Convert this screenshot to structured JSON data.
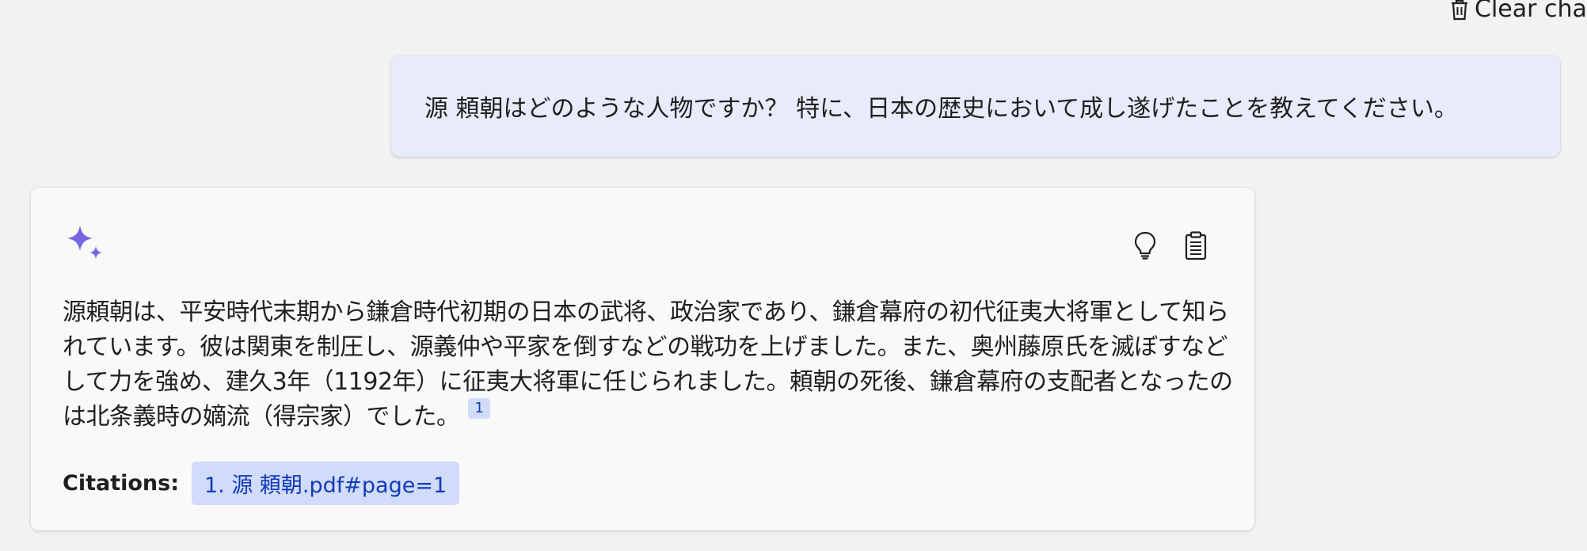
{
  "header": {
    "clear_chat_label": "Clear chat",
    "clear_chat_icon": "trash-icon"
  },
  "user_message": {
    "text": "源 頼朝はどのような人物ですか？ 特に、日本の歴史において成し遂げたことを教えてください。"
  },
  "answer": {
    "avatar_icon": "sparkle-icon",
    "actions": [
      {
        "icon": "lightbulb-icon"
      },
      {
        "icon": "clipboard-icon"
      }
    ],
    "text": "源頼朝は、平安時代末期から鎌倉時代初期の日本の武将、政治家であり、鎌倉幕府の初代征夷大将軍として知られています。彼は関東を制圧し、源義仲や平家を倒すなどの戦功を上げました。また、奥州藤原氏を滅ぼすなどして力を強め、建久3年（1192年）に征夷大将軍に任じられました。頼朝の死後、鎌倉幕府の支配者となったのは北条義時の嫡流（得宗家）でした。",
    "citation_marker": "1",
    "citations_label": "Citations:",
    "citations": [
      "1. 源 頼朝.pdf#page=1"
    ]
  },
  "colors": {
    "background": "#f2f2f2",
    "user_bubble": "#e8ebfa",
    "answer_card": "#f9f9f9",
    "accent": "#7367e2",
    "citation_bg": "#d1dbfa",
    "citation_text": "#123bb6"
  }
}
